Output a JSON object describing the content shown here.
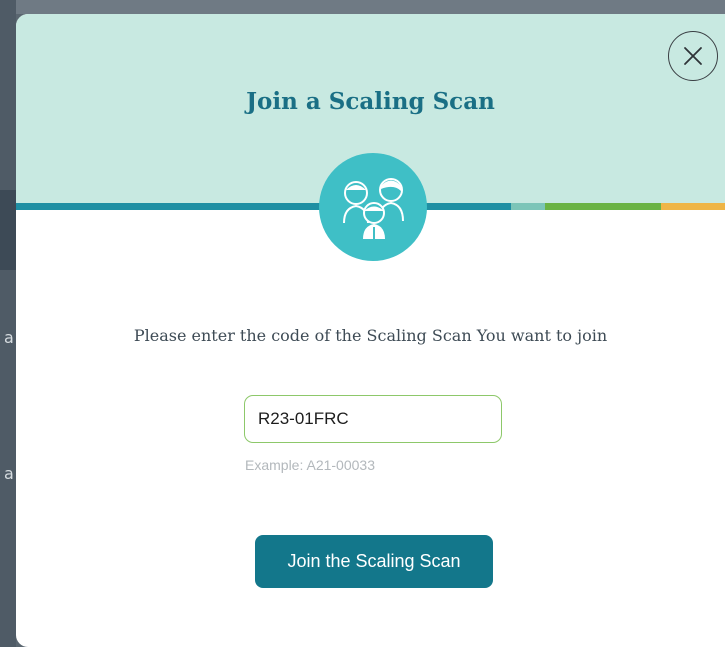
{
  "modal": {
    "title": "Join a Scaling Scan",
    "close_icon": "close-icon",
    "illustration_icon": "group-people-icon",
    "prompt": "Please enter the code of the Scaling Scan You want to join",
    "code_input": {
      "value": "R23-01FRC",
      "placeholder": ""
    },
    "example_hint": "Example: A21-00033",
    "join_button_label": "Join the Scaling Scan"
  },
  "background": {
    "letters": [
      "a",
      "a"
    ]
  },
  "colors": {
    "header_bg": "#c8e9e1",
    "title": "#1a6f85",
    "accent_button": "#13778b",
    "illustration_circle": "#3fbfc6",
    "input_border": "#8dc86a",
    "stripe": [
      "#1f8fa3",
      "#7cc5b8",
      "#6ab344",
      "#efb546"
    ]
  }
}
